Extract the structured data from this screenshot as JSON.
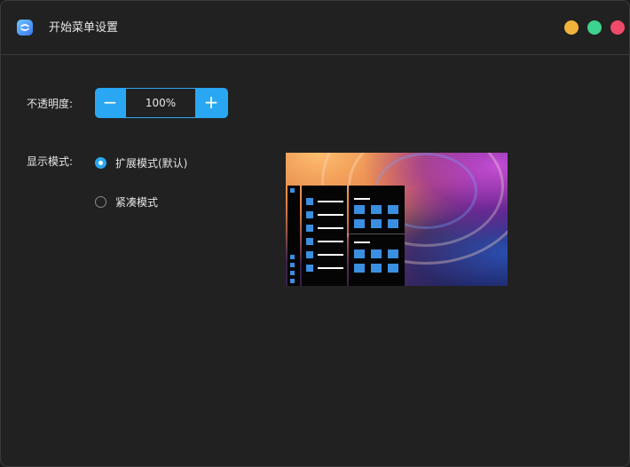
{
  "window": {
    "title": "开始菜单设置",
    "buttons": {
      "minimize_color": "#f0b43c",
      "maximize_color": "#3ed28e",
      "close_color": "#ef4a6a"
    }
  },
  "opacity": {
    "label": "不透明度:",
    "value": "100%",
    "decrement_icon": "minus-icon",
    "increment_icon": "plus-icon",
    "decrement_symbol": "−",
    "increment_symbol": "+"
  },
  "display_mode": {
    "label": "显示模式:",
    "options": [
      {
        "label": "扩展模式(默认)",
        "selected": true
      },
      {
        "label": "紧凑模式",
        "selected": false
      }
    ]
  },
  "accent_color": "#2aa7f2",
  "preview": {
    "description_icon": "start-menu-preview-image"
  }
}
